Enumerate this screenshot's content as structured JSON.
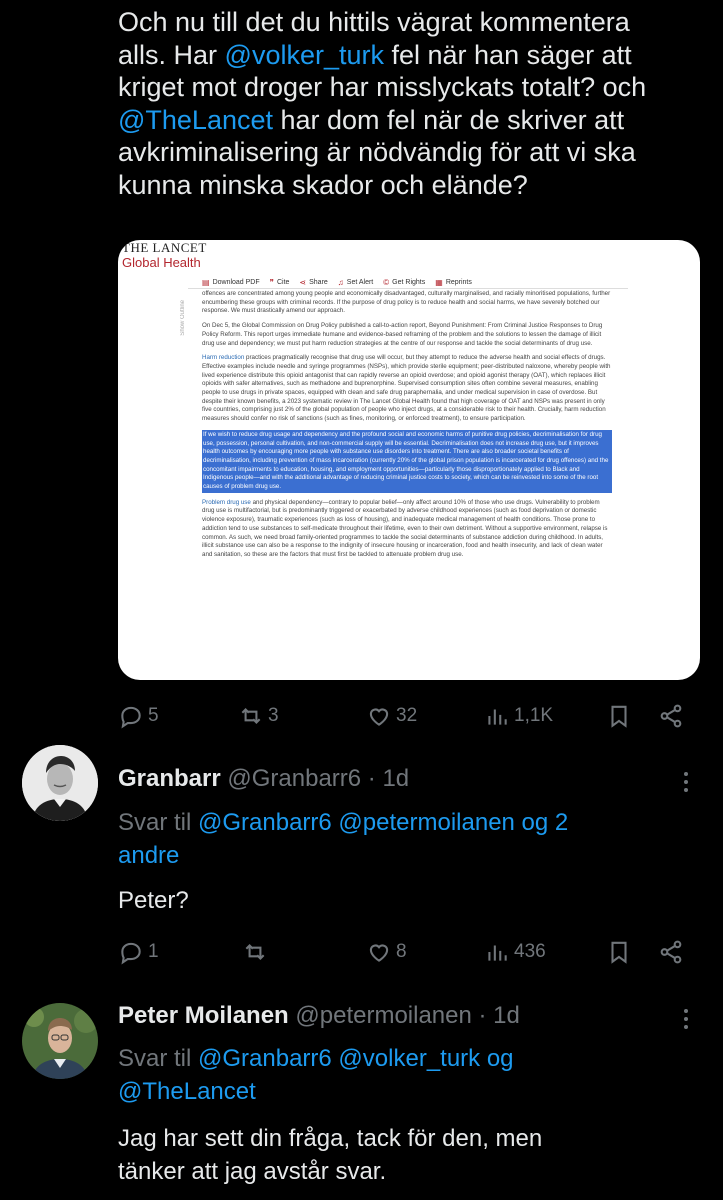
{
  "tweet": {
    "text_line1": "Och nu till det du hittils vägrat kommentera",
    "text_line2_pre": "alls. Har ",
    "mention_volker": "@volker_turk",
    "text_line2_post": " fel när han säger att",
    "text_line3": "kriget mot droger har misslyckats totalt? och",
    "mention_lancet": "@TheLancet",
    "text_line4_post": "  har dom fel när de skriver att",
    "text_line5": "avkriminalisering är nödvändig för att vi ska",
    "text_line6": "kunna minska skador och elände?",
    "stats": {
      "replies": "5",
      "reposts": "3",
      "likes": "32",
      "views": "1,1K"
    }
  },
  "media": {
    "logo_line1": "THE LANCET",
    "logo_line2": "Global Health",
    "toolbar": [
      "Download PDF",
      "Cite",
      "Share",
      "Set Alert",
      "Get Rights",
      "Reprints"
    ],
    "outline_label": "Show Outline",
    "para1": "offences are concentrated among young people and economically disadvantaged, culturally marginalised, and racially minoritised populations, further encumbering these groups with criminal records. If the purpose of drug policy is to reduce health and social harms, we have severely botched our response. We must drastically amend our approach.",
    "para2": "On Dec 5, the Global Commission on Drug Policy published a call-to-action report, Beyond Punishment: From Criminal Justice Responses to Drug Policy Reform. This report urges immediate humane and evidence-based reframing of the problem and the solutions to lessen the damage of illicit drug use and dependency; we must put harm reduction strategies at the centre of our response and tackle the social determinants of drug use.",
    "para3_link": "Harm reduction",
    "para3": " practices pragmatically recognise that drug use will occur, but they attempt to reduce the adverse health and social effects of drugs. Effective examples include needle and syringe programmes (NSPs), which provide sterile equipment; peer-distributed naloxone, whereby people with lived experience distribute this opioid antagonist that can rapidly reverse an opioid overdose; and opioid agonist therapy (OAT), which replaces illicit opioids with safer alternatives, such as methadone and buprenorphine. Supervised consumption sites often combine several measures, enabling people to use drugs in private spaces, equipped with clean and safe drug paraphernalia, and under medical supervision in case of overdose. But despite their known benefits, a 2023 systematic review in The Lancet Global Health found that high coverage of OAT and NSPs was present in only five countries, comprising just 2% of the global population of people who inject drugs, at a considerable risk to their health. Crucially, harm reduction measures should confer no risk of sanctions (such as fines, monitoring, or enforced treatment), to ensure participation.",
    "para4_highlight": "If we wish to reduce drug usage and dependency and the profound social and economic harms of punitive drug policies, decriminalisation for drug use, possession, personal cultivation, and non-commercial supply will be essential. Decriminalisation does not increase drug use, but it improves health outcomes by encouraging more people with substance use disorders into treatment. There are also broader societal benefits of decriminalisation, including prevention of mass incarceration (currently 20% of the global prison population is incarcerated for drug offences) and the concomitant impairments to education, housing, and employment opportunities—particularly those disproportionately applied to Black and Indigenous people—and with the additional advantage of reducing criminal justice costs to society, which can be reinvested into some of the root causes of problem drug use.",
    "para5_link": "Problem drug use",
    "para5": " and physical dependency—contrary to popular belief—only affect around 10% of those who use drugs. Vulnerability to problem drug use is multifactorial, but is predominantly triggered or exacerbated by adverse childhood experiences (such as food deprivation or domestic violence exposure), traumatic experiences (such as loss of housing), and inadequate medical management of health conditions. Those prone to addiction tend to use substances to self-medicate throughout their lifetime, even to their own detriment. Without a supportive environment, relapse is common. As such, we need broad family-oriented programmes to tackle the social determinants of substance addiction during childhood. In adults, illicit substance use can also be a response to the indignity of insecure housing or incarceration, food and health insecurity, and lack of clean water and sanitation, so these are the factors that must first be tackled to attenuate problem drug use."
  },
  "reply1": {
    "name": "Granbarr",
    "handle": "@Granbarr6 · 1d",
    "reply_prefix": "Svar til ",
    "reply_mentions_line1": "@Granbarr6 @petermoilanen og 2",
    "reply_mentions_line2": "andre",
    "body": "Peter?",
    "stats": {
      "replies": "1",
      "reposts": "",
      "likes": "8",
      "views": "436"
    }
  },
  "reply2": {
    "name": "Peter Moilanen",
    "handle": "@petermoilanen · 1d",
    "reply_prefix": "Svar til ",
    "reply_mentions_line1": "@Granbarr6 @volker_turk og",
    "reply_mentions_line2": "@TheLancet",
    "body_line1": "Jag har sett din fråga, tack för den, men",
    "body_line2": "tänker att jag avstår svar."
  }
}
